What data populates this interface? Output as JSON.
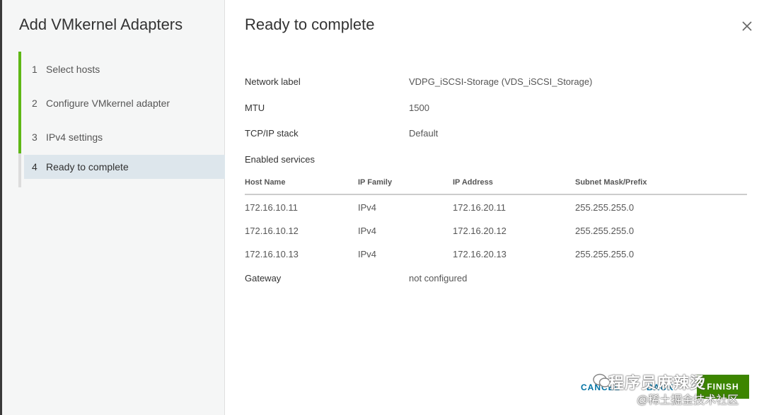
{
  "wizard": {
    "title": "Add VMkernel Adapters",
    "steps": [
      {
        "num": "1",
        "label": "Select hosts"
      },
      {
        "num": "2",
        "label": "Configure VMkernel adapter"
      },
      {
        "num": "3",
        "label": "IPv4 settings"
      },
      {
        "num": "4",
        "label": "Ready to complete"
      }
    ]
  },
  "page": {
    "title": "Ready to complete",
    "close_icon": "close-icon"
  },
  "summary": {
    "network_label_label": "Network label",
    "network_label_value": "VDPG_iSCSI-Storage (VDS_iSCSI_Storage)",
    "mtu_label": "MTU",
    "mtu_value": "1500",
    "tcpip_label": "TCP/IP stack",
    "tcpip_value": "Default",
    "enabled_services_label": "Enabled services",
    "gateway_label": "Gateway",
    "gateway_value": "not configured"
  },
  "hosts_table": {
    "headers": [
      "Host Name",
      "IP Family",
      "IP Address",
      "Subnet Mask/Prefix"
    ],
    "rows": [
      [
        "172.16.10.11",
        "IPv4",
        "172.16.20.11",
        "255.255.255.0"
      ],
      [
        "172.16.10.12",
        "IPv4",
        "172.16.20.12",
        "255.255.255.0"
      ],
      [
        "172.16.10.13",
        "IPv4",
        "172.16.20.13",
        "255.255.255.0"
      ]
    ]
  },
  "footer": {
    "cancel_label": "CANCEL",
    "back_label": "BACK",
    "finish_label": "FINISH"
  },
  "watermark": {
    "line1": "程序员麻辣烫",
    "line2": "@稀土掘金技术社区"
  },
  "colors": {
    "completed_step": "#5eb715",
    "active_step_bg": "#dde6ec",
    "link": "#0072a3",
    "finish_button": "#3c8500"
  }
}
